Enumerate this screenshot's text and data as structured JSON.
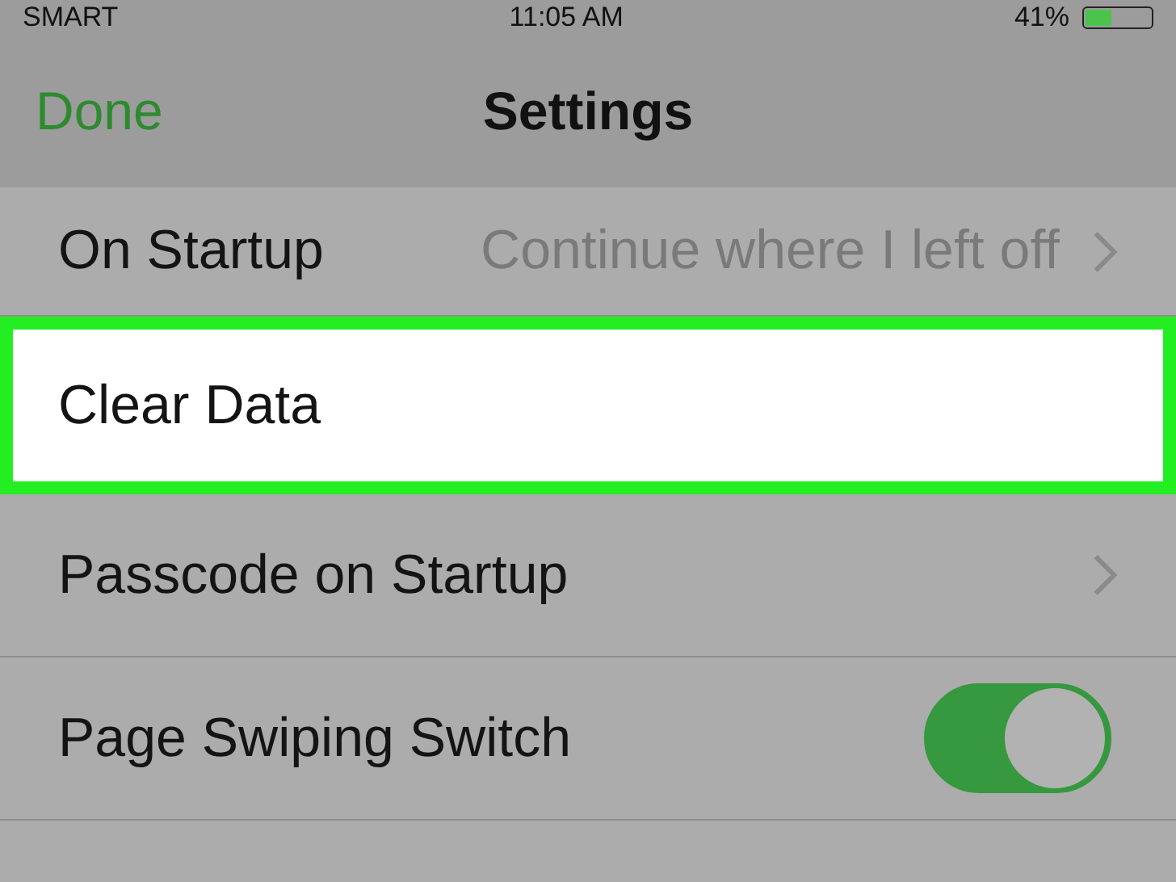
{
  "status_bar": {
    "carrier": "SMART",
    "time": "11:05 AM",
    "battery": "41%"
  },
  "nav": {
    "left_button": "Done",
    "title": "Settings"
  },
  "rows": [
    {
      "kind": "value",
      "label": "On Startup",
      "value": "Continue where I left off",
      "selected": false
    },
    {
      "kind": "plain",
      "label": "Clear Data",
      "selected": true
    },
    {
      "kind": "link",
      "label": "Passcode on Startup",
      "selected": false
    },
    {
      "kind": "switch",
      "label": "Page Swiping Switch",
      "on": true,
      "selected": false
    }
  ]
}
